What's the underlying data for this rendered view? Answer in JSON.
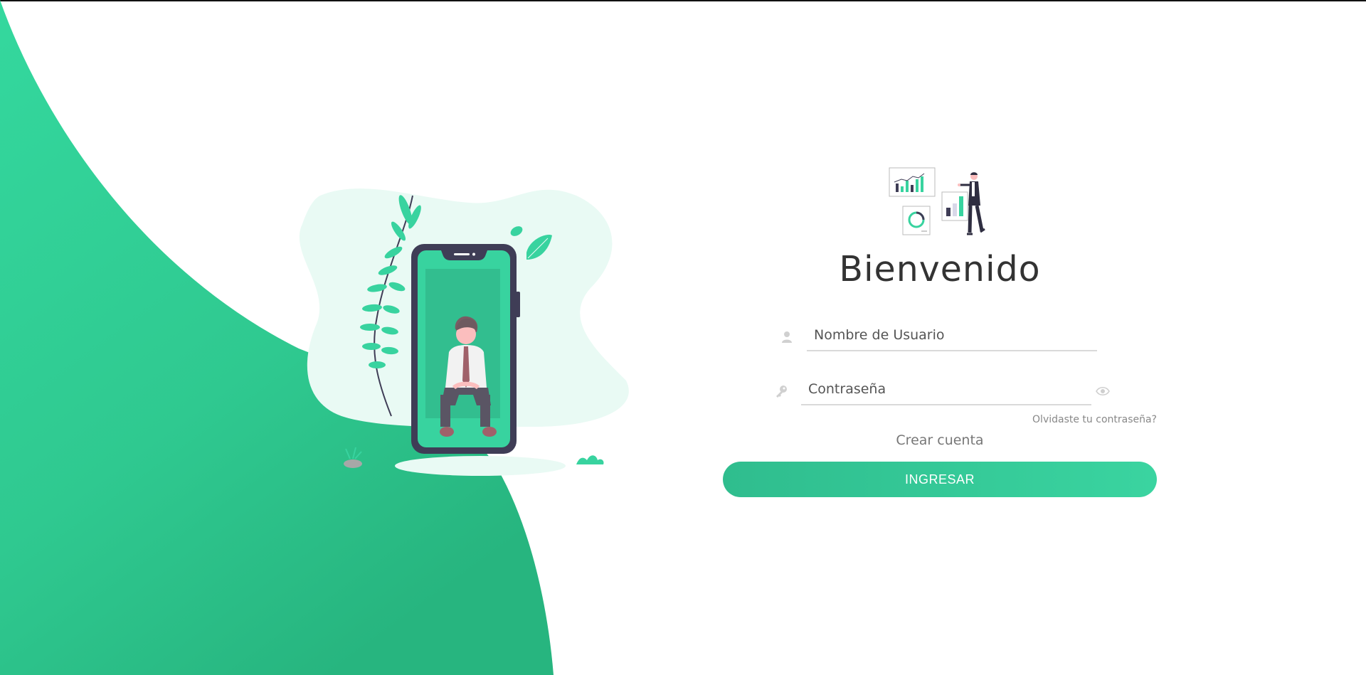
{
  "login": {
    "title": "Bienvenido",
    "username_placeholder": "Nombre de Usuario",
    "password_placeholder": "Contraseña",
    "forgot_password": "Olvidaste tu contraseña?",
    "create_account": "Crear cuenta",
    "submit_label": "INGRESAR"
  },
  "icons": {
    "username": "user-icon",
    "password": "key-icon",
    "show_password": "eye-icon"
  },
  "colors": {
    "accent": "#38d39f",
    "accent_dark": "#2fbd8e",
    "phone_frame": "#3f3d56",
    "blob_light": "#e9faf4",
    "title_text": "#333333"
  }
}
